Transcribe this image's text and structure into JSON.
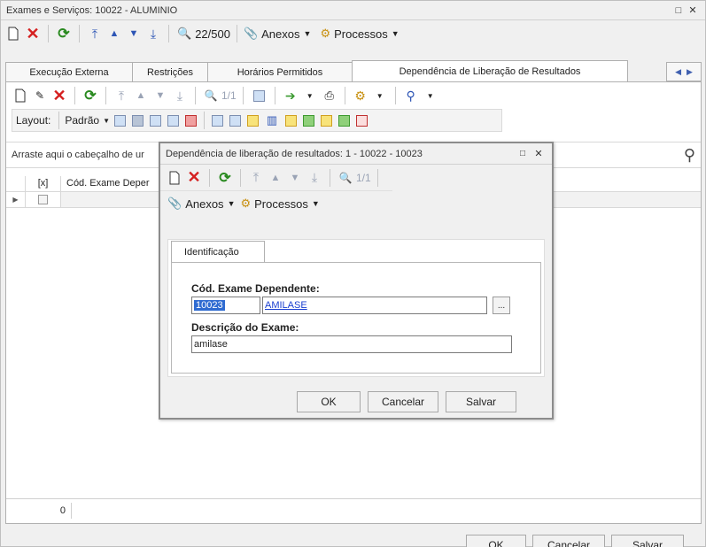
{
  "window": {
    "title": "Exames e Serviços: 10022 - ALUMINIO",
    "controls": [
      "□",
      "✕"
    ]
  },
  "main_toolbar": {
    "record_position": "22/500",
    "anexos_label": "Anexos",
    "processos_label": "Processos"
  },
  "tabs": [
    {
      "label": "Execução Externa",
      "active": false
    },
    {
      "label": "Restrições",
      "active": false
    },
    {
      "label": "Horários Permitidos",
      "active": false
    },
    {
      "label": "Dependência de Liberação de Resultados",
      "active": true
    }
  ],
  "panel_toolbar": {
    "record_position": "1/1"
  },
  "layout_bar": {
    "label": "Layout:",
    "preset": "Padrão"
  },
  "grid": {
    "group_hint": "Arraste aqui o cabeçalho de ur",
    "columns": [
      "[x]",
      "Cód. Exame Deper"
    ],
    "row_count": "0"
  },
  "main_buttons": {
    "ok": "OK",
    "cancel": "Cancelar",
    "save": "Salvar"
  },
  "dialog": {
    "title": "Dependência de liberação de resultados: 1 - 10022 - 10023",
    "record_position": "1/1",
    "anexos_label": "Anexos",
    "processos_label": "Processos",
    "tab_label": "Identificação",
    "field_code_label": "Cód. Exame Dependente:",
    "field_code_value": "10023",
    "field_code_name": "AMILASE",
    "ellipsis": "...",
    "field_desc_label": "Descrição do Exame:",
    "field_desc_value": "amilase",
    "ok": "OK",
    "cancel": "Cancelar",
    "save": "Salvar"
  }
}
